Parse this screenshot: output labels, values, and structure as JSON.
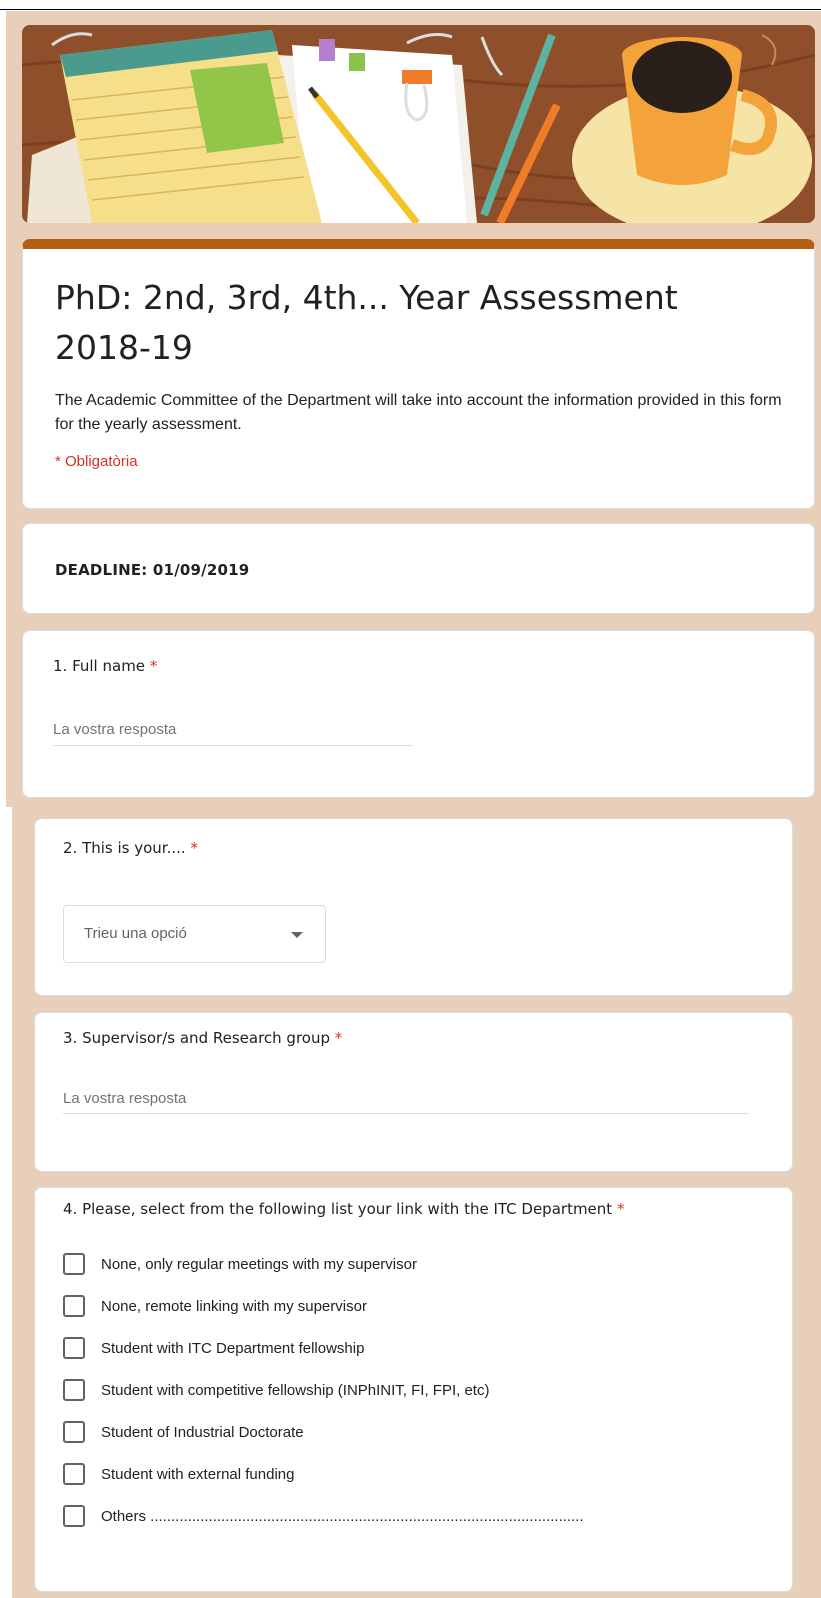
{
  "colors": {
    "accent": "#b75d14",
    "background": "#e7cfb9",
    "required": "#d93025"
  },
  "form": {
    "title": "PhD: 2nd, 3rd, 4th... Year Assessment 2018-19",
    "description": "The Academic Committee of the Department will take into account the information provided in this form for the yearly assessment.",
    "required_note": "* Obligatòria"
  },
  "deadline": {
    "text": "DEADLINE: 01/09/2019"
  },
  "questions": [
    {
      "label": "1. Full name",
      "required": "*",
      "placeholder": "La vostra resposta"
    },
    {
      "label": "2. This is your....",
      "required": "*",
      "placeholder": "Trieu una opció",
      "icon": "caret-down-icon"
    },
    {
      "label": "3. Supervisor/s and Research group",
      "required": "*",
      "placeholder": "La vostra resposta"
    },
    {
      "label": "4. Please, select from the following list your link with the ITC Department",
      "required": "*",
      "options": [
        "None, only regular meetings with my supervisor",
        "None, remote linking with my supervisor",
        "Student with ITC Department fellowship",
        "Student with competitive fellowship (INPhINIT, FI, FPI, etc)",
        "Student of Industrial Doctorate",
        "Student with external funding",
        "Others ........................................................................................................"
      ]
    }
  ]
}
